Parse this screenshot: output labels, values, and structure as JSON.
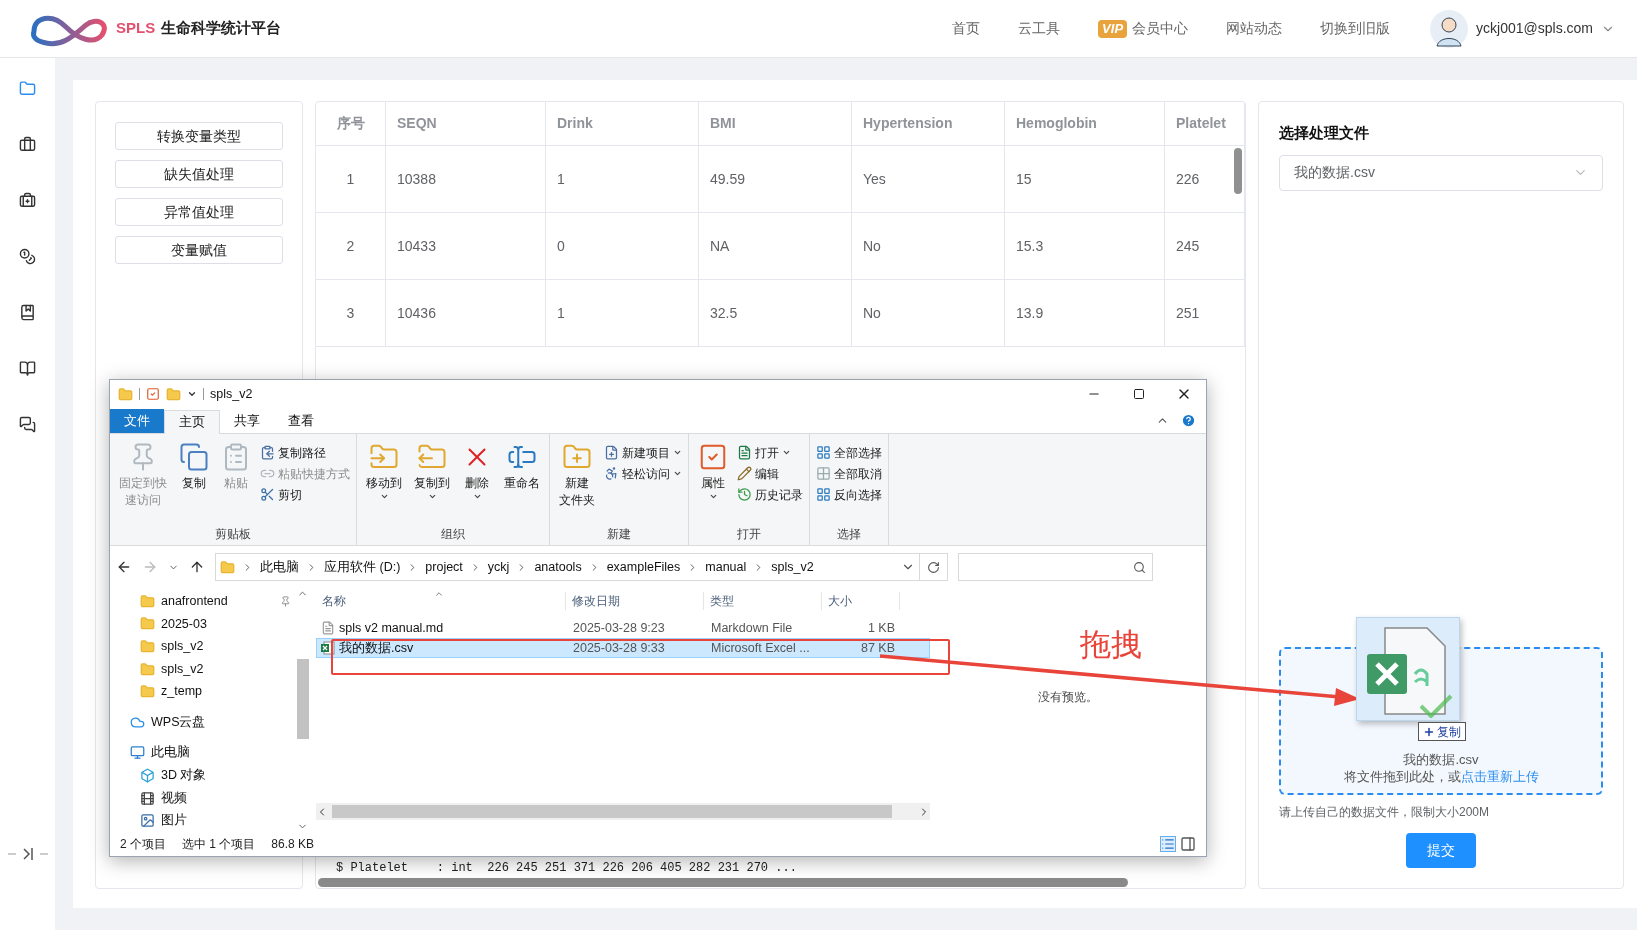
{
  "header": {
    "brand": "SPLS",
    "title": "生命科学统计平台",
    "nav": [
      {
        "label": "首页"
      },
      {
        "label": "云工具"
      },
      {
        "label": "会员中心",
        "badge": "VIP"
      },
      {
        "label": "网站动态"
      },
      {
        "label": "切换到旧版"
      }
    ],
    "user": "yckj001@spls.com"
  },
  "sidebar": [
    {
      "selected": true
    },
    {
      "selected": false
    },
    {
      "selected": false
    },
    {
      "selected": false
    },
    {
      "selected": false
    },
    {
      "selected": false
    },
    {
      "selected": false
    }
  ],
  "tools": [
    "转换变量类型",
    "缺失值处理",
    "异常值处理",
    "变量赋值"
  ],
  "table": {
    "columns": [
      "序号",
      "SEQN",
      "Drink",
      "BMI",
      "Hypertension",
      "Hemoglobin",
      "Platelet"
    ],
    "rows": [
      [
        "1",
        "10388",
        "1",
        "49.59",
        "Yes",
        "15",
        "226"
      ],
      [
        "2",
        "10433",
        "0",
        "NA",
        "No",
        "15.3",
        "245"
      ],
      [
        "3",
        "10436",
        "1",
        "32.5",
        "No",
        "13.9",
        "251"
      ]
    ]
  },
  "console_line": "$ Platelet    : int  226 245 251 371 226 206 405 282 231 270 ...",
  "right_panel": {
    "title": "选择处理文件",
    "select_value": "我的数据.csv",
    "upload": {
      "file_name": "我的数据.csv",
      "hint": "将文件拖到此处，或",
      "link": "点击重新上传"
    },
    "note": "请上传自己的数据文件，限制大小200M",
    "submit": "提交"
  },
  "explorer": {
    "title": "spls_v2",
    "ribbon_tabs": [
      {
        "label": "文件",
        "kind": "file",
        "selected": false
      },
      {
        "label": "主页",
        "kind": "tab",
        "selected": true
      },
      {
        "label": "共享",
        "kind": "tab",
        "selected": false
      },
      {
        "label": "查看",
        "kind": "tab",
        "selected": false
      }
    ],
    "groups": [
      {
        "label": "剪贴板",
        "items": [
          {
            "label": [
              "固定到快",
              "速访问"
            ],
            "kind": "large",
            "disabled": true,
            "menu": false
          },
          {
            "label": [
              "复制"
            ],
            "kind": "large",
            "disabled": false,
            "menu": false
          },
          {
            "label": [
              "粘贴"
            ],
            "kind": "large",
            "disabled": true,
            "menu": false
          },
          {
            "label": "复制路径",
            "kind": "small",
            "disabled": false,
            "menu": false
          },
          {
            "label": "粘贴快捷方式",
            "kind": "small",
            "disabled": true,
            "menu": false
          },
          {
            "label": "剪切",
            "kind": "small",
            "disabled": false,
            "menu": false
          }
        ]
      },
      {
        "label": "组织",
        "items": [
          {
            "label": [
              "移动到"
            ],
            "kind": "large",
            "disabled": false,
            "menu": true
          },
          {
            "label": [
              "复制到"
            ],
            "kind": "large",
            "disabled": false,
            "menu": true
          },
          {
            "label": [
              "删除"
            ],
            "kind": "large",
            "disabled": false,
            "menu": true
          },
          {
            "label": [
              "重命名"
            ],
            "kind": "large",
            "disabled": false,
            "menu": false
          }
        ]
      },
      {
        "label": "新建",
        "items": [
          {
            "label": [
              "新建",
              "文件夹"
            ],
            "kind": "large",
            "disabled": false,
            "menu": false
          },
          {
            "label": "新建项目",
            "kind": "small",
            "disabled": false,
            "menu": true
          },
          {
            "label": "轻松访问",
            "kind": "small",
            "disabled": false,
            "menu": true
          }
        ]
      },
      {
        "label": "打开",
        "items": [
          {
            "label": [
              "属性"
            ],
            "kind": "large",
            "disabled": false,
            "menu": true
          },
          {
            "label": "打开",
            "kind": "small",
            "disabled": false,
            "menu": true
          },
          {
            "label": "编辑",
            "kind": "small",
            "disabled": false,
            "menu": false
          },
          {
            "label": "历史记录",
            "kind": "small",
            "disabled": false,
            "menu": false
          }
        ]
      },
      {
        "label": "选择",
        "items": [
          {
            "label": "全部选择",
            "kind": "small",
            "disabled": false,
            "menu": false
          },
          {
            "label": "全部取消",
            "kind": "small",
            "disabled": false,
            "menu": false
          },
          {
            "label": "反向选择",
            "kind": "small",
            "disabled": false,
            "menu": false
          }
        ]
      }
    ],
    "path": [
      "此电脑",
      "应用软件 (D:)",
      "project",
      "yckj",
      "anatools",
      "exampleFiles",
      "manual",
      "spls_v2"
    ],
    "tree": [
      {
        "label": "anafrontend",
        "kind": "folder",
        "pinned": true
      },
      {
        "label": "2025-03",
        "kind": "folder",
        "pinned": false
      },
      {
        "label": "spls_v2",
        "kind": "folder",
        "pinned": false
      },
      {
        "label": "spls_v2",
        "kind": "folder",
        "pinned": false
      },
      {
        "label": "z_temp",
        "kind": "folder",
        "pinned": false
      },
      {
        "label": "WPS云盘",
        "kind": "cloud",
        "pinned": false
      },
      {
        "label": "此电脑",
        "kind": "pc",
        "pinned": false,
        "children": [
          {
            "label": "3D 对象",
            "kind": "cube",
            "pinned": false
          },
          {
            "label": "视频",
            "kind": "video",
            "pinned": false
          },
          {
            "label": "图片",
            "kind": "image",
            "pinned": false
          }
        ]
      }
    ],
    "columns": [
      "名称",
      "修改日期",
      "类型",
      "大小"
    ],
    "files": [
      {
        "name": "spls v2 manual.md",
        "date": "2025-03-28 9:23",
        "type": "Markdown File",
        "size": "1 KB",
        "kind": "markdown",
        "selected": false
      },
      {
        "name": "我的数据.csv",
        "date": "2025-03-28 9:33",
        "type": "Microsoft Excel ...",
        "size": "87 KB",
        "kind": "excel",
        "selected": true
      }
    ],
    "preview": "没有预览。",
    "status": [
      "2 个项目",
      "选中 1 个项目",
      "86.8 KB"
    ]
  },
  "annotation": "拖拽",
  "drag_badge": "复制"
}
